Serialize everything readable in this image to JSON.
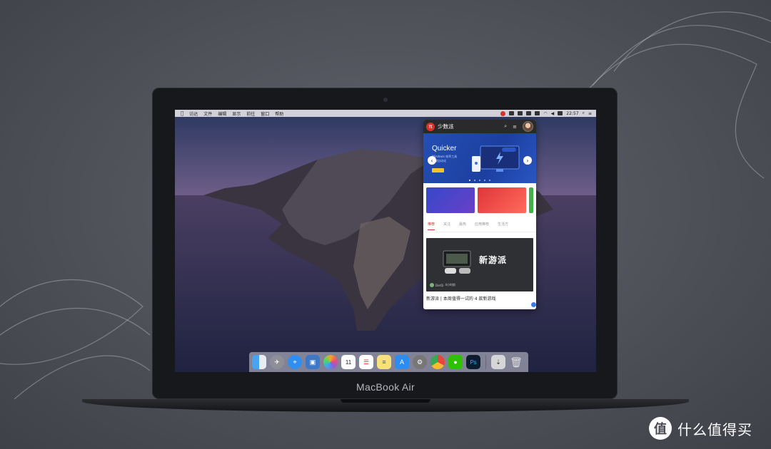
{
  "device": {
    "brand_label": "MacBook Air"
  },
  "menubar": {
    "apple": "",
    "items": [
      "访达",
      "文件",
      "编辑",
      "显示",
      "前往",
      "窗口",
      "帮助"
    ],
    "clock": "22:57"
  },
  "popover": {
    "title": "少数派",
    "banner": {
      "title": "Quicker",
      "subtitle_line1": "Windows 效率工具",
      "subtitle_line2": "一键自动化"
    },
    "tabs": [
      "推荐",
      "关注",
      "最热",
      "应用推荐",
      "生活方"
    ],
    "active_tab": "推荐",
    "article": {
      "thumb_text": "新游派",
      "author": "DerQi",
      "time": "4小时前",
      "caption": "新游派 | 本周值得一试的 4 款新游戏"
    }
  },
  "dock": {
    "icons": [
      "finder-icon",
      "launchpad-icon",
      "safari-icon",
      "preview-icon",
      "photos-icon",
      "calendar-icon",
      "reminders-icon",
      "notes-icon",
      "app-store-icon",
      "system-preferences-icon",
      "chrome-icon",
      "wechat-icon",
      "photoshop-icon",
      "downloads-icon",
      "trash-icon"
    ],
    "calendar_day": "11",
    "photoshop_label": "Ps"
  },
  "watermark": {
    "logo": "值",
    "text": "什么值得买"
  }
}
